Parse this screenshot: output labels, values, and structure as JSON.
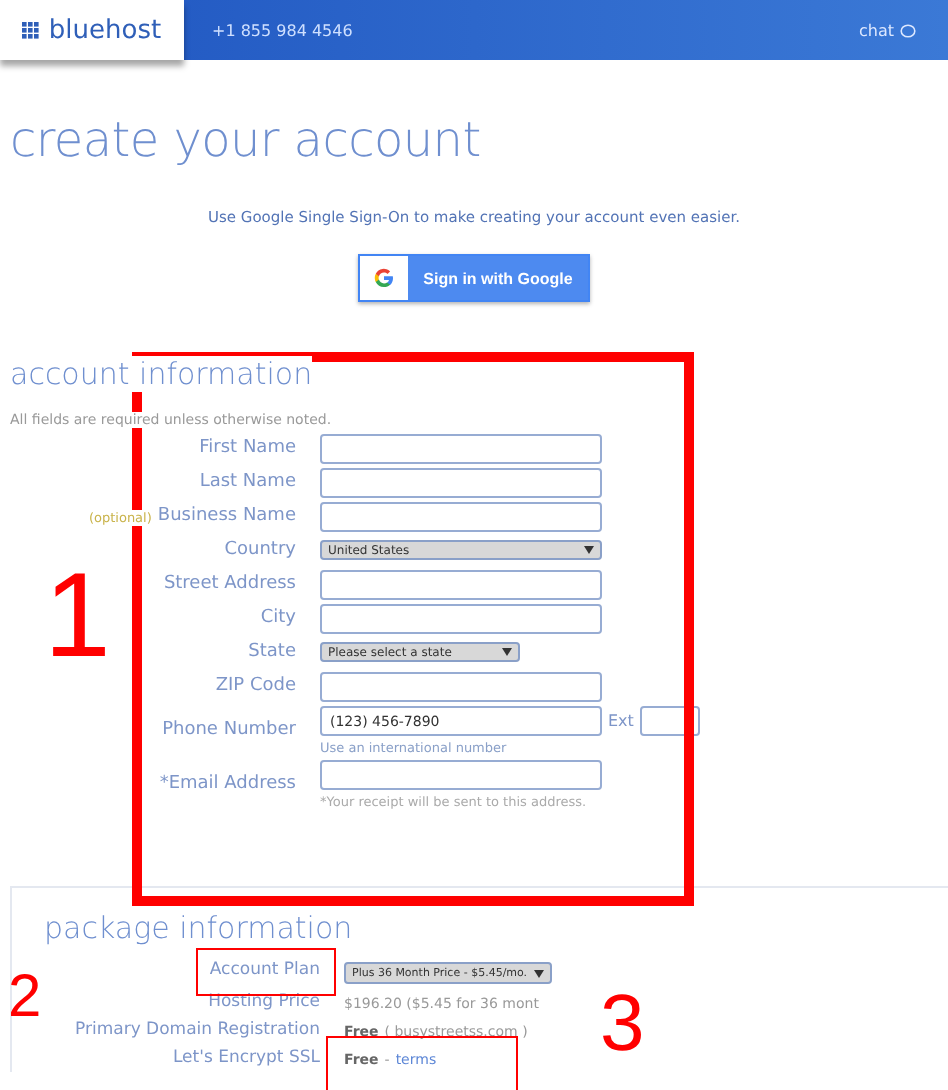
{
  "header": {
    "logo": "bluehost",
    "phone": "+1 855 984 4546",
    "chat": "chat"
  },
  "title": "create your account",
  "sso": {
    "prompt": "Use Google Single Sign-On to make creating your account even easier.",
    "button": "Sign in with Google"
  },
  "account_information": {
    "heading": "account information",
    "note": "All fields are required unless otherwise noted.",
    "fields": [
      {
        "kind": "text",
        "label": "First Name"
      },
      {
        "kind": "text",
        "label": "Last Name"
      },
      {
        "kind": "text",
        "label": "Business Name",
        "optional": "(optional)"
      },
      {
        "kind": "select",
        "label": "Country",
        "value": "United States",
        "wide": true
      },
      {
        "kind": "text",
        "label": "Street Address"
      },
      {
        "kind": "text",
        "label": "City"
      },
      {
        "kind": "select",
        "label": "State",
        "value": "Please select a state",
        "wide": false
      },
      {
        "kind": "text",
        "label": "ZIP Code"
      },
      {
        "kind": "phone",
        "label": "Phone Number",
        "placeholder": "(123) 456-7890",
        "ext": "Ext",
        "hint": "Use an international number"
      },
      {
        "kind": "text",
        "label": "*Email Address",
        "hint": "*Your receipt will be sent to this address."
      }
    ]
  },
  "package_information": {
    "heading": "package information",
    "rows": [
      {
        "kind": "select",
        "label": "Account Plan",
        "value": "Plus 36 Month Price - $5.45/mo."
      },
      {
        "kind": "text",
        "label": "Hosting Price",
        "value": "$196.20  ($5.45 for 36 mont"
      },
      {
        "kind": "text",
        "label": "Primary Domain Registration",
        "value": "Free",
        "detail": "( busystreetss.com )"
      },
      {
        "kind": "link",
        "label": "Let's Encrypt SSL",
        "value": "Free",
        "separator": "-",
        "link": "terms"
      }
    ]
  },
  "annotations": [
    "1",
    "2",
    "3"
  ]
}
